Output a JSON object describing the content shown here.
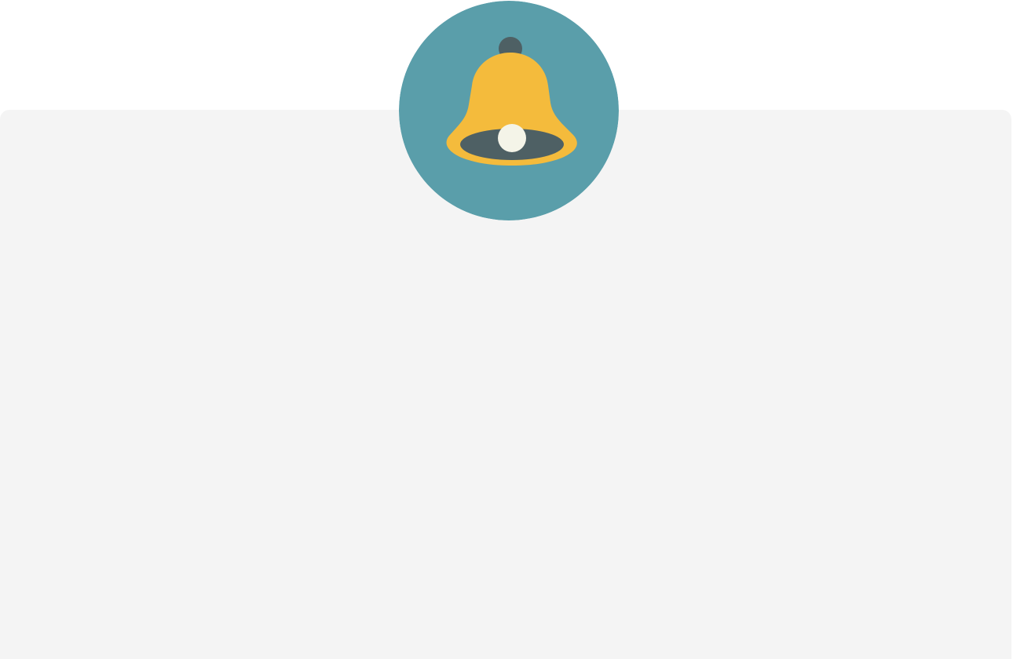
{
  "colors": {
    "page_background": "#ffffff",
    "panel_background": "#f4f4f4",
    "badge_background": "#5a9eaa",
    "bell_body": "#f4bb3c",
    "bell_dark": "#4e6064",
    "bell_clapper": "#f4f4e8"
  },
  "icons": {
    "badge_icon": "bell-icon"
  }
}
